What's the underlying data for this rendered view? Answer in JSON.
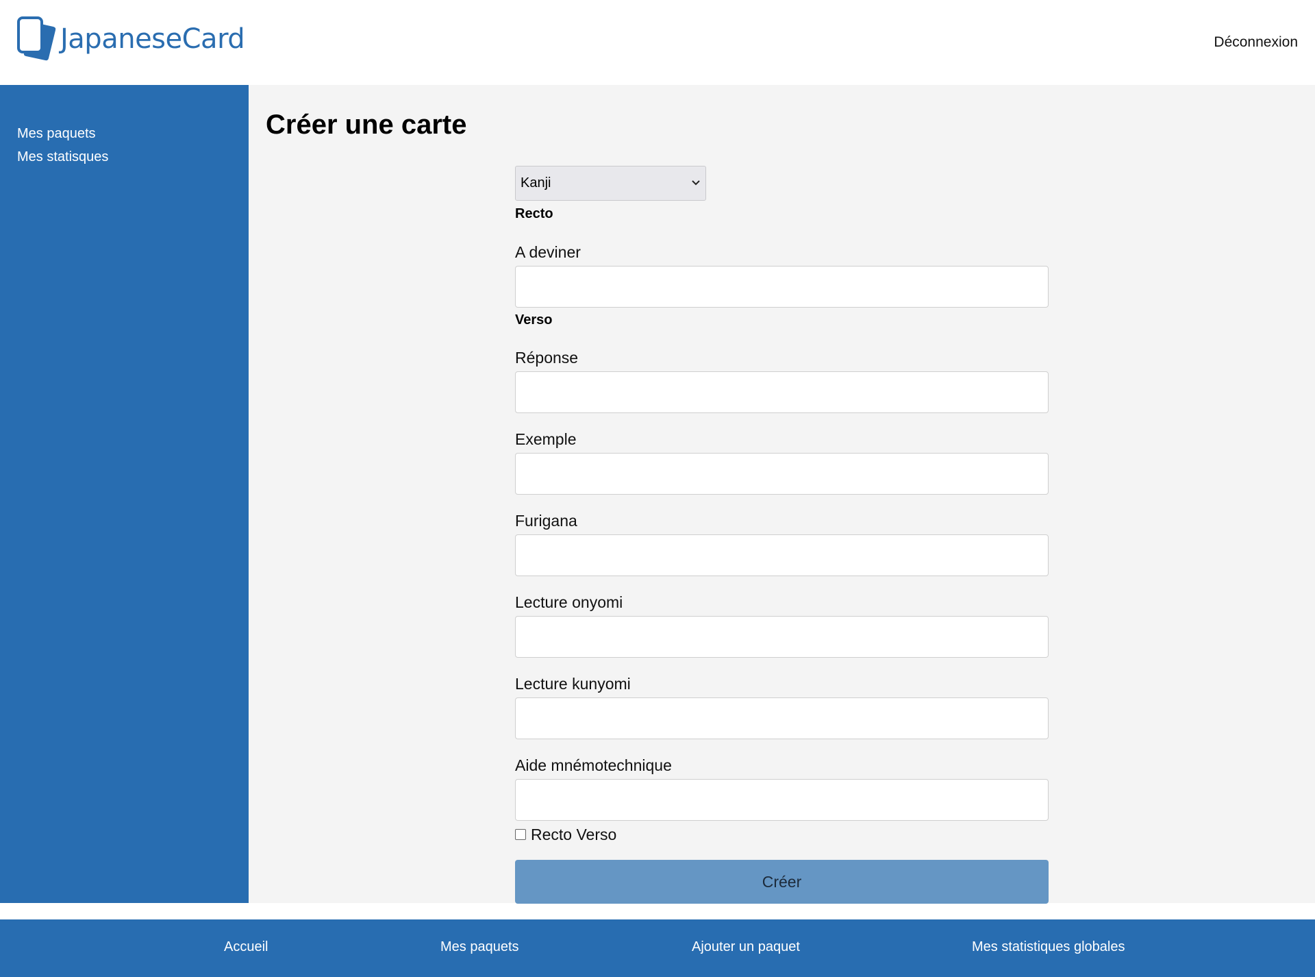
{
  "header": {
    "logo_text": "JapaneseCard",
    "logout_label": "Déconnexion"
  },
  "sidebar": {
    "items": [
      {
        "label": "Mes paquets"
      },
      {
        "label": "Mes statisques"
      }
    ]
  },
  "main": {
    "title": "Créer une carte",
    "form": {
      "type_select": {
        "selected": "Kanji"
      },
      "recto_title": "Recto",
      "verso_title": "Verso",
      "fields": {
        "a_deviner": {
          "label": "A deviner",
          "value": ""
        },
        "reponse": {
          "label": "Réponse",
          "value": ""
        },
        "exemple": {
          "label": "Exemple",
          "value": ""
        },
        "furigana": {
          "label": "Furigana",
          "value": ""
        },
        "lecture_onyomi": {
          "label": "Lecture onyomi",
          "value": ""
        },
        "lecture_kunyomi": {
          "label": "Lecture kunyomi",
          "value": ""
        },
        "aide_mnemotechnique": {
          "label": "Aide mnémotechnique",
          "value": ""
        }
      },
      "recto_verso": {
        "label": "Recto Verso",
        "checked": false
      },
      "submit_label": "Créer"
    }
  },
  "footer": {
    "links": [
      {
        "label": "Accueil"
      },
      {
        "label": "Mes paquets"
      },
      {
        "label": "Ajouter un paquet"
      },
      {
        "label": "Mes statistiques globales"
      }
    ]
  },
  "colors": {
    "brand": "#286db1",
    "logo_text": "#2a6db0",
    "button": "#6596c4",
    "main_bg": "#f4f4f4"
  }
}
